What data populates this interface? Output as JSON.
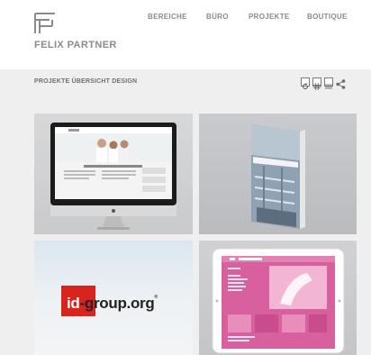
{
  "brand": {
    "name": "FELIX PARTNER",
    "logo_icon": "fp-monogram-icon"
  },
  "nav": {
    "items": [
      "BEREICHE",
      "BÜRO",
      "PROJEKTE",
      "BOUTIQUE"
    ]
  },
  "sub_header": {
    "title": "PROJEKTE ÜBERSICHT DESIGN",
    "view_icons": [
      "refresh-icon",
      "grid-view-icon",
      "list-view-icon",
      "share-icon"
    ]
  },
  "projects": [
    {
      "kind": "imac-website-mockup"
    },
    {
      "kind": "architecture-book"
    },
    {
      "kind": "id-group-logo",
      "logo_text_white": "id",
      "logo_text_dark": "-group.org",
      "logo_mark": "®"
    },
    {
      "kind": "ipad-pink-website"
    }
  ],
  "colors": {
    "accent_red": "#d9231c",
    "accent_pink": "#d9609f",
    "bar_gray": "#efefef",
    "text_gray": "#8a8a8a"
  }
}
